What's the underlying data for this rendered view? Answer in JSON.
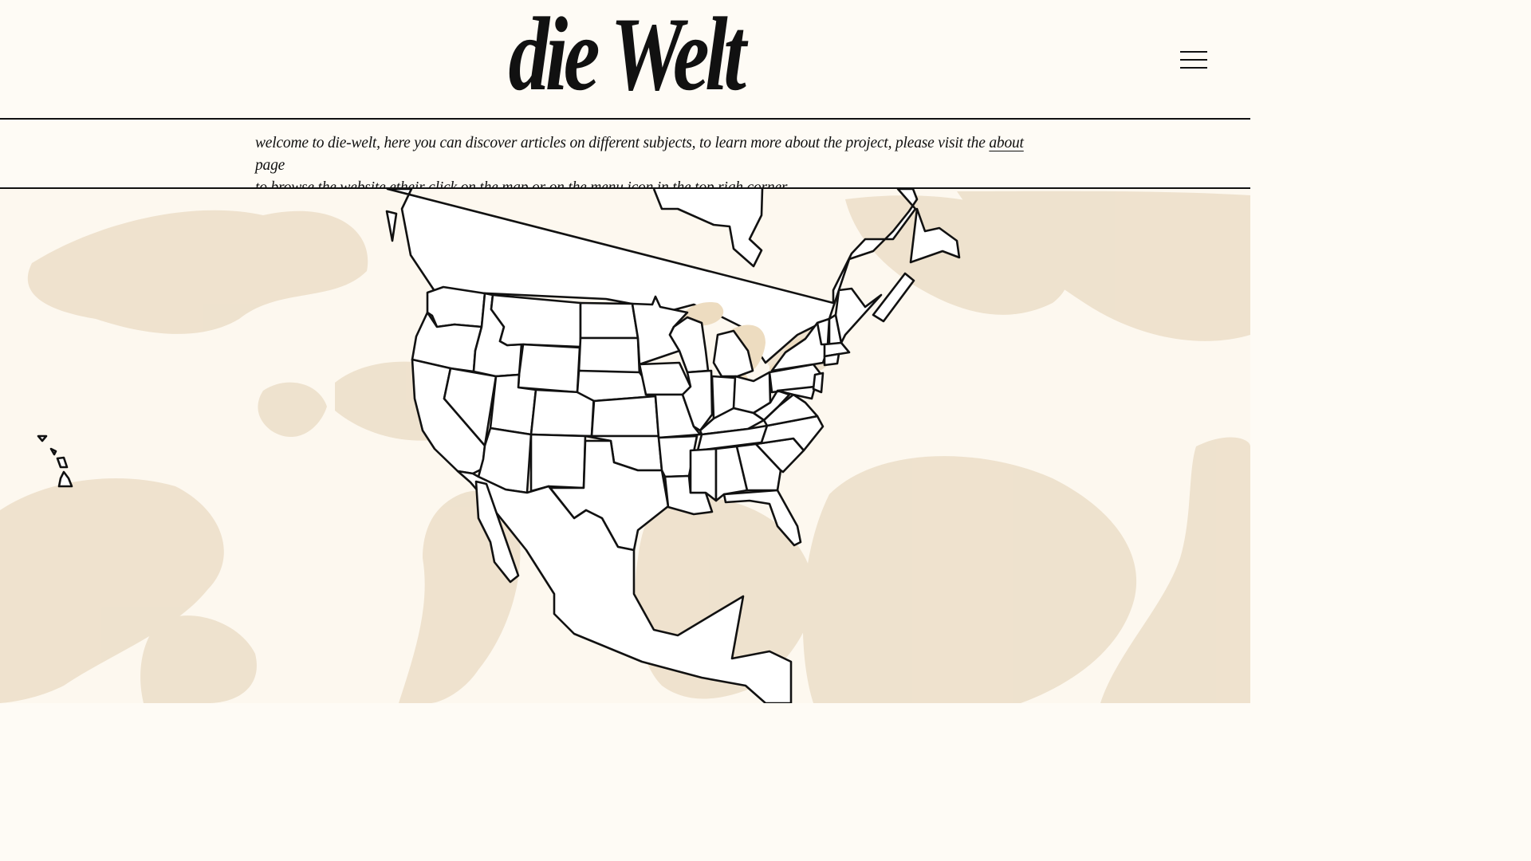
{
  "header": {
    "logo": "die Welt",
    "menu_icon": "hamburger-menu-icon"
  },
  "banner": {
    "text_before_link": "welcome to die-welt, here you can discover articles on different subjects, to learn more about the project, please visit the ",
    "link_label": "about",
    "text_after_link": " page",
    "line2": "to browse the website etheir click on the map or on the menu icon in the top righ corner",
    "close_icon": "close-icon"
  },
  "map": {
    "background_color": "#fdf8ef",
    "stain_color": "#eadbc3",
    "lake_color": "#eddcc0",
    "outline_color": "#111111"
  }
}
